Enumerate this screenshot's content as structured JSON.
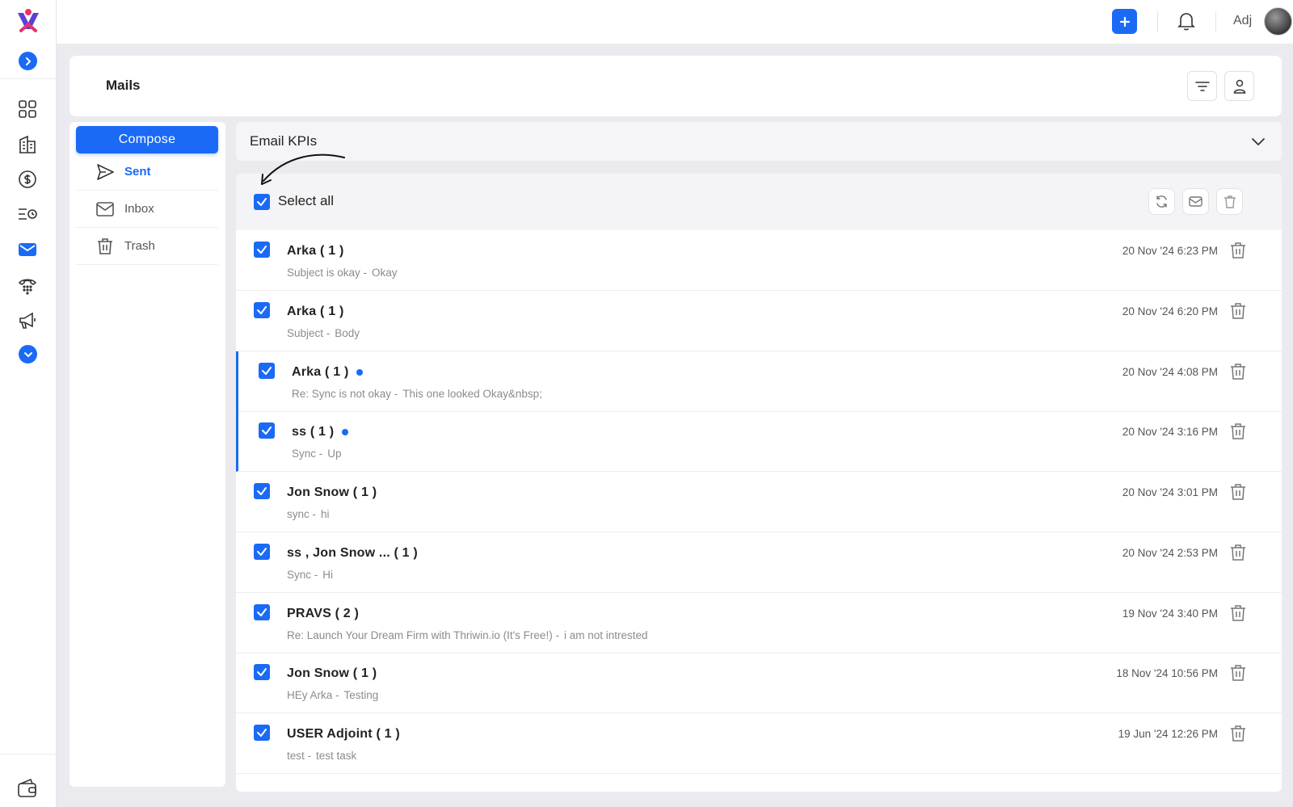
{
  "topbar": {
    "user_name": "Adj"
  },
  "header": {
    "title": "Mails"
  },
  "folders": {
    "compose_label": "Compose",
    "items": [
      {
        "label": "Sent",
        "icon": "send-icon",
        "active": true
      },
      {
        "label": "Inbox",
        "icon": "envelope-icon",
        "active": false
      },
      {
        "label": "Trash",
        "icon": "trash-icon",
        "active": false
      }
    ]
  },
  "kpi": {
    "title": "Email KPIs"
  },
  "list": {
    "select_all_label": "Select all",
    "emails": [
      {
        "sender": "Arka ( 1 )",
        "subject": "Subject is okay -",
        "body": "Okay",
        "time": "20 Nov '24 6:23 PM",
        "unread": false
      },
      {
        "sender": "Arka ( 1 )",
        "subject": "Subject -",
        "body": "Body",
        "time": "20 Nov '24 6:20 PM",
        "unread": false
      },
      {
        "sender": "Arka ( 1 )",
        "subject": "Re: Sync is not okay -",
        "body": "This one looked Okay&nbsp;",
        "time": "20 Nov '24 4:08 PM",
        "unread": true
      },
      {
        "sender": "ss ( 1 )",
        "subject": "Sync -",
        "body": "Up",
        "time": "20 Nov '24 3:16 PM",
        "unread": true
      },
      {
        "sender": "Jon Snow ( 1 )",
        "subject": "sync -",
        "body": "hi",
        "time": "20 Nov '24 3:01 PM",
        "unread": false
      },
      {
        "sender": "ss ,   Jon Snow ... ( 1 )",
        "subject": "Sync -",
        "body": "Hi",
        "time": "20 Nov '24 2:53 PM",
        "unread": false
      },
      {
        "sender": "PRAVS ( 2 )",
        "subject": "Re: Launch Your Dream Firm with Thriwin.io (It's Free!) -",
        "body": "i am not intrested",
        "time": "19 Nov '24 3:40 PM",
        "unread": false
      },
      {
        "sender": "Jon Snow ( 1 )",
        "subject": "HEy Arka -",
        "body": "Testing",
        "time": "18 Nov '24 10:56 PM",
        "unread": false
      },
      {
        "sender": "USER Adjoint ( 1 )",
        "subject": "test -",
        "body": "test task",
        "time": "19 Jun '24 12:26 PM",
        "unread": false
      }
    ]
  },
  "colors": {
    "accent": "#1a6af5",
    "muted_text": "#8b8b92",
    "background": "#ebebef"
  }
}
